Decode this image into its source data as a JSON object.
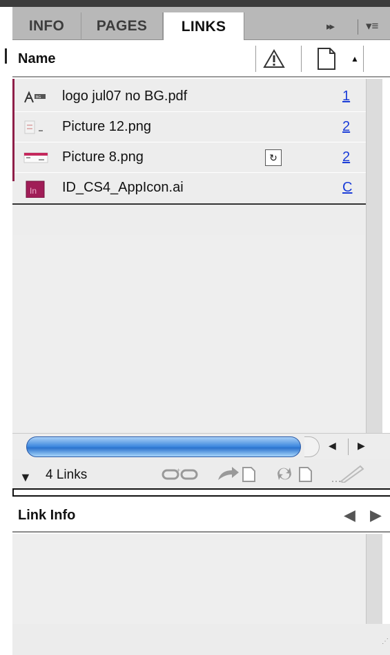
{
  "tabs": [
    {
      "label": "INFO"
    },
    {
      "label": "PAGES"
    },
    {
      "label": "LINKS"
    }
  ],
  "tab_controls": {
    "forward": "▸▸",
    "menu": "▾≡"
  },
  "header": {
    "name_label": "Name"
  },
  "links": [
    {
      "name": "logo jul07 no BG.pdf",
      "page": "1",
      "status": "",
      "icon": "pdf-logo-thumbnail"
    },
    {
      "name": "Picture 12.png",
      "page": "2",
      "status": "",
      "icon": "png-thumbnail"
    },
    {
      "name": "Picture 8.png",
      "page": "2",
      "status": "modified",
      "icon": "png-thumbnail-red"
    },
    {
      "name": "ID_CS4_AppIcon.ai",
      "page": "C",
      "status": "",
      "icon": "indesign-icon"
    }
  ],
  "statusbar": {
    "count": "4 Links"
  },
  "link_info": {
    "title": "Link Info"
  },
  "colors": {
    "accent_pink": "#8e1e48",
    "scroll_blue": "#3b86dd",
    "page_link_blue": "#1a3cd8"
  }
}
